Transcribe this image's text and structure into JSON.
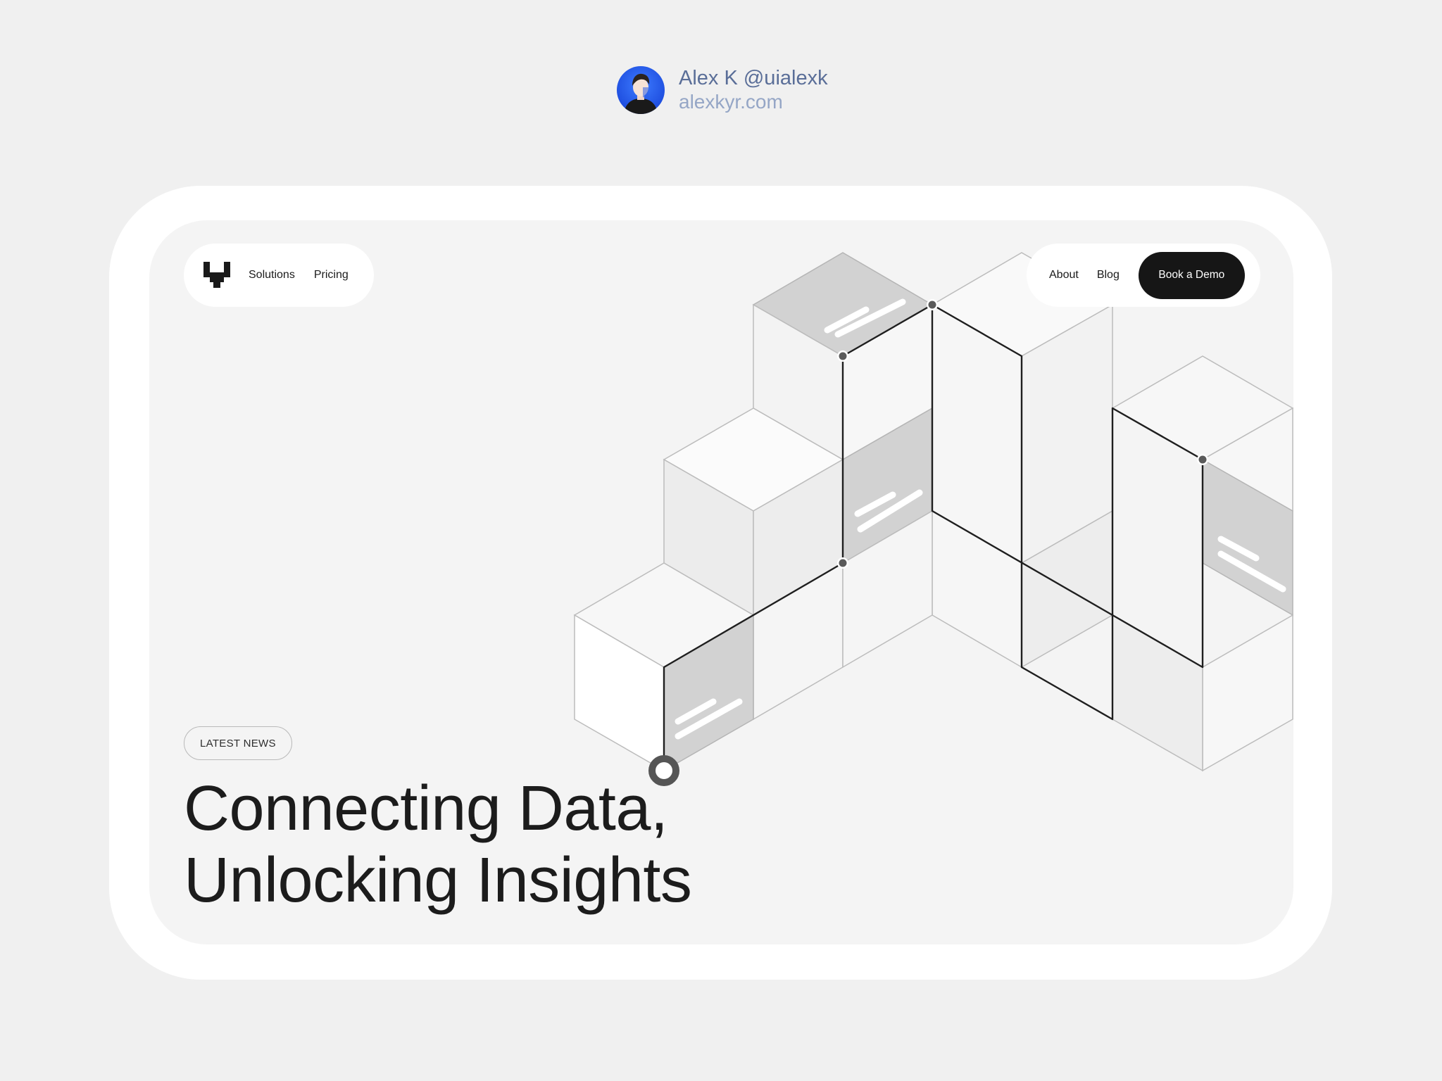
{
  "author": {
    "name": "Alex K @uialexk",
    "site": "alexkyr.com",
    "avatar_icon": "avatar-illustration-icon"
  },
  "nav": {
    "logo_icon": "brand-logo-icon",
    "left_links": [
      "Solutions",
      "Pricing"
    ],
    "right_links": [
      "About",
      "Blog"
    ],
    "cta_label": "Book a Demo"
  },
  "hero": {
    "badge": "LATEST NEWS",
    "headline_line1": "Connecting Data,",
    "headline_line2": "Unlocking Insights"
  },
  "colors": {
    "page_bg": "#f0f0f0",
    "card_bg": "#ffffff",
    "panel_bg": "#f4f4f4",
    "ink": "#1c1c1c",
    "cta_bg": "#161616",
    "author_name": "#5a6e98",
    "author_site": "#95a6c6",
    "cube_dark_face": "#d2d2d2",
    "node": "#5a5a5a"
  },
  "illustration": {
    "name": "isometric-cube-network-illustration"
  }
}
